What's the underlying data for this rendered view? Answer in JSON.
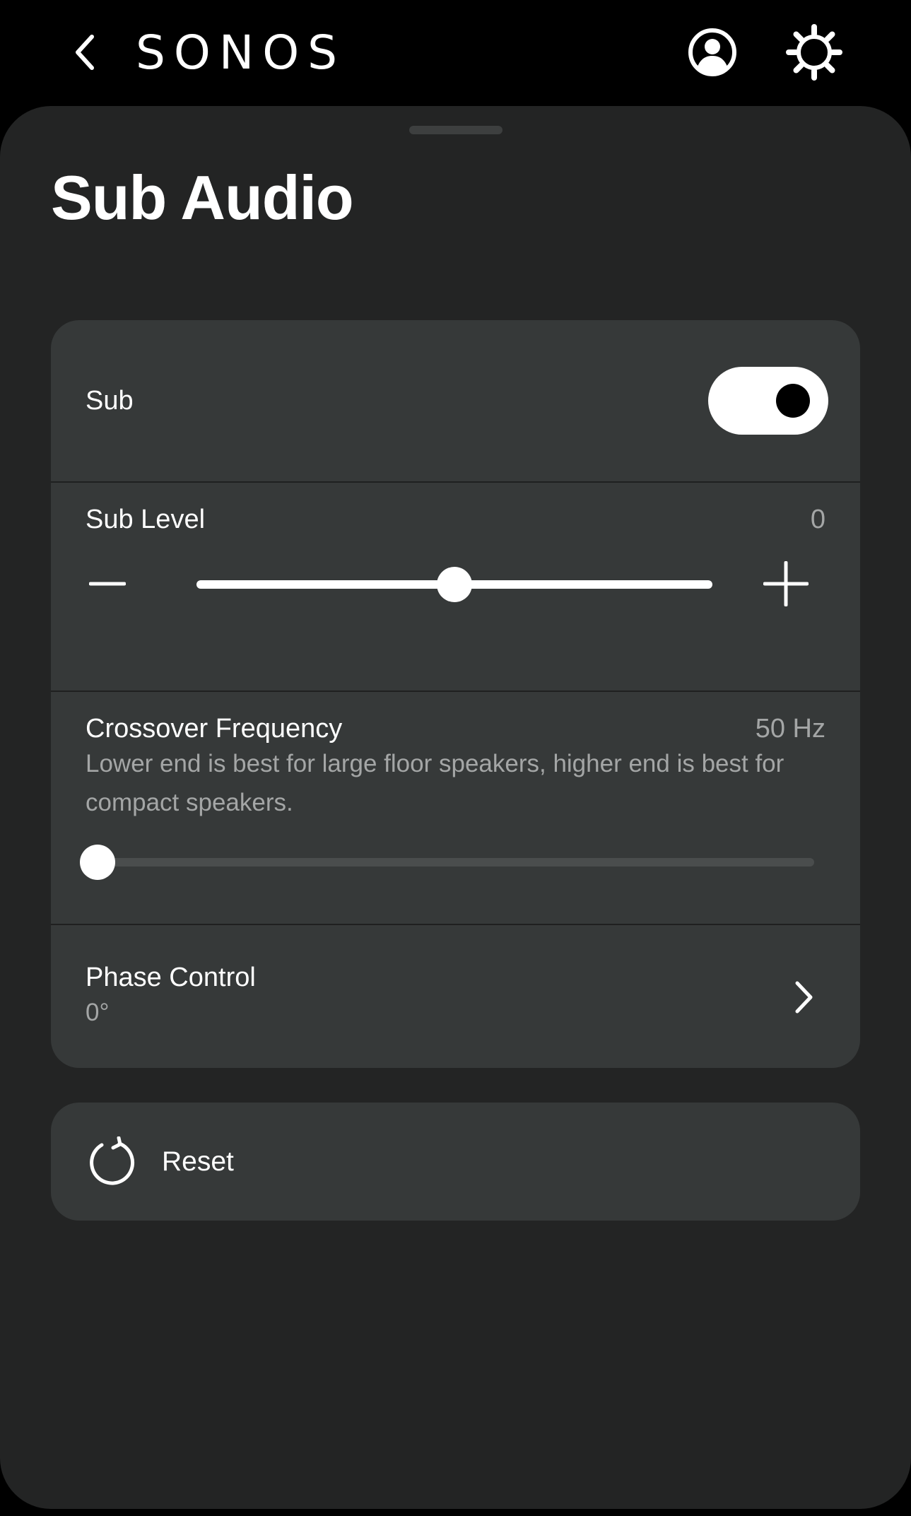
{
  "header": {
    "back_icon": "chevron-left-icon",
    "logo_text": "SONOS",
    "account_icon": "account-icon",
    "settings_icon": "gear-icon"
  },
  "page": {
    "title": "Sub Audio"
  },
  "sub": {
    "label": "Sub",
    "enabled": true
  },
  "sub_level": {
    "label": "Sub Level",
    "value": "0",
    "decrease_icon": "minus-icon",
    "increase_icon": "plus-icon",
    "slider_position": 0.5
  },
  "crossover": {
    "label": "Crossover Frequency",
    "value": "50 Hz",
    "description": "Lower end is best for large floor speakers, higher end is best for compact speakers.",
    "slider_position": 0.0
  },
  "phase": {
    "label": "Phase Control",
    "value": "0°",
    "chevron_icon": "chevron-right-icon"
  },
  "reset": {
    "label": "Reset",
    "icon": "reset-icon"
  },
  "colors": {
    "background": "#000000",
    "sheet": "#232424",
    "card": "#363939",
    "secondary_text": "#a4a6a6",
    "track_inactive": "#4a4d4d",
    "accent": "#ffffff"
  }
}
